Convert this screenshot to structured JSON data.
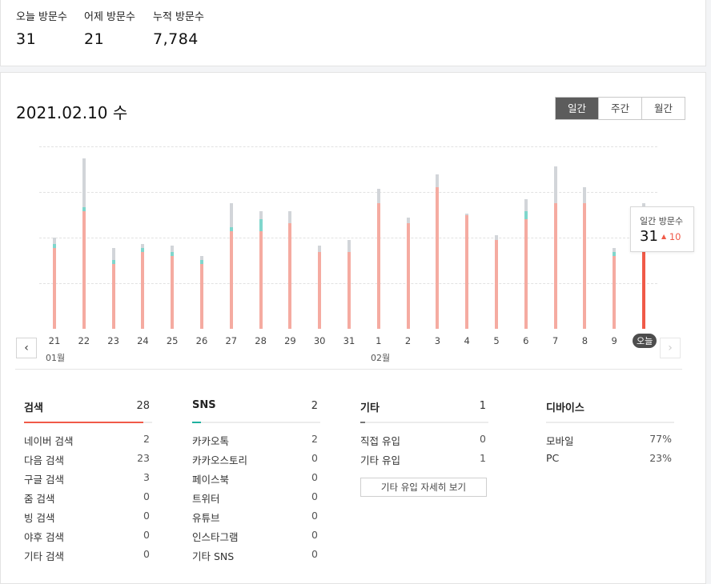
{
  "summary": [
    {
      "label": "오늘 방문수",
      "value": "31"
    },
    {
      "label": "어제 방문수",
      "value": "21"
    },
    {
      "label": "누적 방문수",
      "value": "7,784"
    }
  ],
  "date_title": "2021.02.10 수",
  "period_tabs": [
    "일간",
    "주간",
    "월간"
  ],
  "month_labels": [
    "01월",
    "02월"
  ],
  "today_label": "오늘",
  "tooltip": {
    "title": "일간 방문수",
    "value": "31",
    "delta_icon": "up-arrow-icon",
    "delta": "10"
  },
  "colors": {
    "search": "#f5aba1",
    "sns": "#7fd6cc",
    "other": "#d2d5d9",
    "today": "#f05a48",
    "today_sns": "#1eb09f"
  },
  "chart_data": {
    "type": "bar",
    "stacked": true,
    "categories": [
      "21",
      "22",
      "23",
      "24",
      "25",
      "26",
      "27",
      "28",
      "29",
      "30",
      "31",
      "1",
      "2",
      "3",
      "4",
      "5",
      "6",
      "7",
      "8",
      "9",
      "오늘"
    ],
    "series": [
      {
        "name": "검색",
        "values": [
          20,
          29,
          16,
          19,
          18,
          16,
          24,
          24,
          26,
          19,
          19,
          31,
          26,
          35,
          28,
          22,
          27,
          31,
          31,
          18,
          28
        ]
      },
      {
        "name": "SNS",
        "values": [
          1,
          1,
          1,
          1,
          1,
          1,
          1,
          3,
          0,
          0,
          0,
          0,
          0,
          0,
          0,
          0,
          2,
          0,
          0,
          1,
          2
        ]
      },
      {
        "name": "기타",
        "values": [
          1.5,
          12,
          3,
          1,
          1.5,
          1,
          6,
          2,
          3,
          1.5,
          3,
          3.5,
          1.5,
          3,
          0.5,
          1,
          3,
          9,
          4,
          1,
          1
        ]
      }
    ],
    "ylim": [
      0,
      45
    ],
    "grid": true
  },
  "categories_panel": [
    {
      "name": "검색",
      "count": "28",
      "accent": "#f05a48",
      "accent_ratio": 0.93,
      "rows": [
        [
          "네이버 검색",
          "2"
        ],
        [
          "다음 검색",
          "23"
        ],
        [
          "구글 검색",
          "3"
        ],
        [
          "줌 검색",
          "0"
        ],
        [
          "빙 검색",
          "0"
        ],
        [
          "야후 검색",
          "0"
        ],
        [
          "기타 검색",
          "0"
        ]
      ]
    },
    {
      "name": "SNS",
      "count": "2",
      "accent": "#1eb09f",
      "accent_ratio": 0.07,
      "rows": [
        [
          "카카오톡",
          "2"
        ],
        [
          "카카오스토리",
          "0"
        ],
        [
          "페이스북",
          "0"
        ],
        [
          "트위터",
          "0"
        ],
        [
          "유튜브",
          "0"
        ],
        [
          "인스타그램",
          "0"
        ],
        [
          "기타 SNS",
          "0"
        ]
      ]
    },
    {
      "name": "기타",
      "count": "1",
      "accent": "#777777",
      "accent_ratio": 0.03,
      "rows": [
        [
          "직접 유입",
          "0"
        ],
        [
          "기타 유입",
          "1"
        ]
      ],
      "button": "기타 유입 자세히 보기"
    },
    {
      "name": "디바이스",
      "count": "",
      "accent": "",
      "accent_ratio": 0,
      "rows": [
        [
          "모바일",
          "77%"
        ],
        [
          "PC",
          "23%"
        ]
      ]
    }
  ]
}
